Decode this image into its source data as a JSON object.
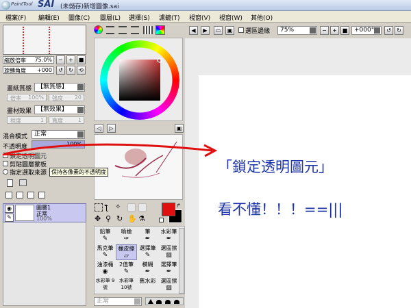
{
  "titlebar": {
    "logo_small": "PaintTool",
    "logo_sai": "SAI",
    "title": "(未儲存)新增圖像.sai"
  },
  "menu": [
    "檔案(F)",
    "編輯(E)",
    "圖像(C)",
    "圖層(L)",
    "選擇(S)",
    "濾鏡(T)",
    "視窗(V)",
    "視窗(W)",
    "其他(O)"
  ],
  "navigator": {
    "zoom_label": "縮放倍率",
    "zoom_value": "75.0%",
    "angle_label": "旋轉角度",
    "angle_value": "+000"
  },
  "paper": {
    "texture_label": "畫紙質感",
    "texture_value": "【無質感】",
    "texture_scale_label": "倍率",
    "texture_scale_value": "100%",
    "texture_strength_label": "強度",
    "texture_strength_value": "20",
    "effect_label": "畫材效果",
    "effect_value": "【無效果】",
    "effect_degree_label": "程度",
    "effect_degree_value": "1",
    "effect_width_label": "寬度",
    "effect_width_value": "1"
  },
  "layer_props": {
    "blend_label": "混合模式",
    "blend_value": "正常",
    "opacity_label": "不透明度",
    "opacity_value": "100%",
    "lock_alpha_label": "鎖定透明圖元",
    "clip_label": "剪貼圖層蒙板",
    "selection_source_label": "指定選取來源",
    "tooltip": "保持各像素的不透明度"
  },
  "layers": [
    {
      "name": "圖層1",
      "mode": "正常",
      "opacity": "100%"
    }
  ],
  "canvas_toolbar": {
    "select_edge_label": "選區邊緣",
    "zoom_value": "75%",
    "angle_value": "+000°"
  },
  "tools": {
    "row1": [
      "鉛筆",
      "噴槍",
      "筆",
      "水彩筆"
    ],
    "row2": [
      "馬克筆",
      "橡皮擦",
      "選擇筆",
      "選區擦"
    ],
    "row3": [
      "油漆桶",
      "2值筆",
      "模糊",
      "選擇筆"
    ],
    "row4": [
      "水彩筆 9號",
      "水彩筆 10號",
      "舊水彩",
      "選區擦"
    ],
    "brush_mode": "正常"
  },
  "annotations": {
    "quote": "「鎖定透明圖元」",
    "comment": "看不懂！！！==|||"
  },
  "colors": {
    "primary": "#e01010",
    "secondary": "#000000",
    "arrow": "#e01010",
    "annotation": "#1d33a8",
    "layer_highlight": "#c8c8f0"
  }
}
